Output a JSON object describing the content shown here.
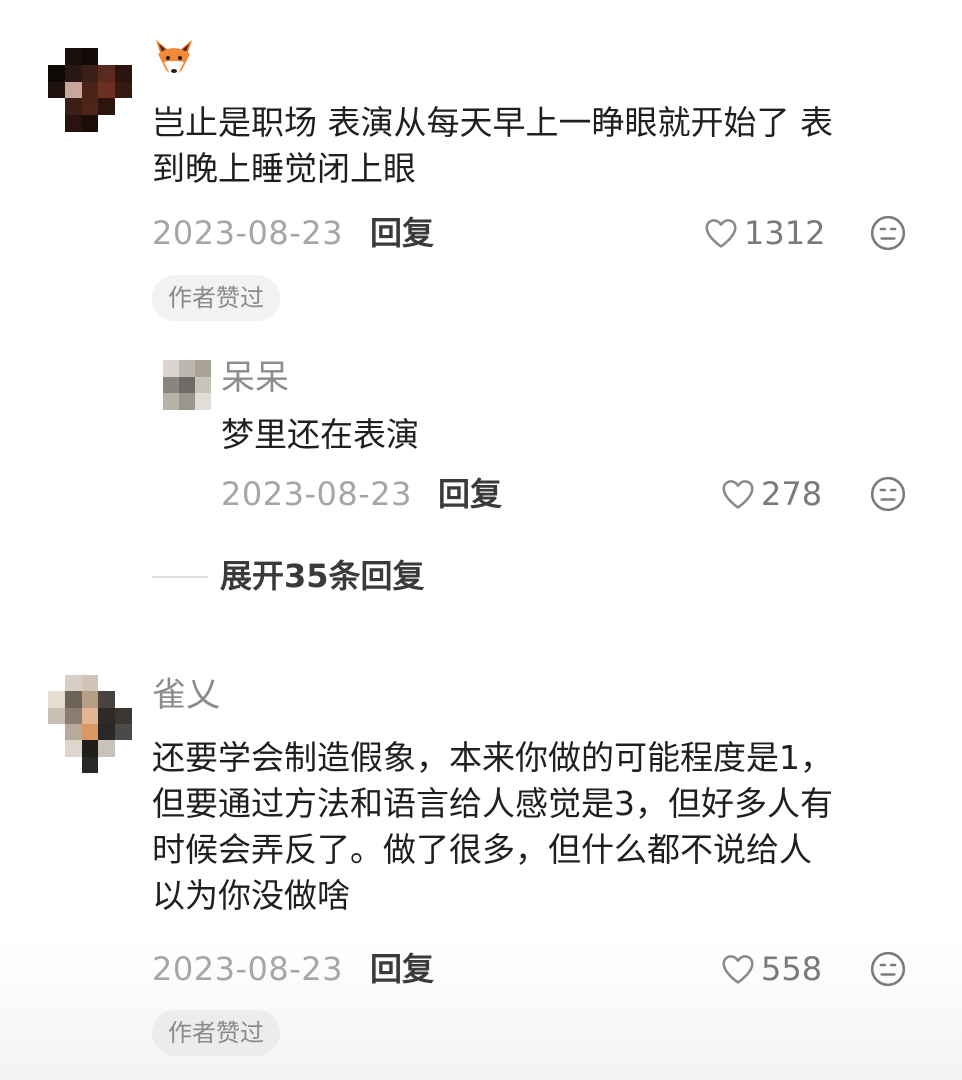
{
  "comments": [
    {
      "username": "",
      "username_emoji": "fox-icon",
      "text": "岂止是职场 表演从每天早上一睁眼就开始了 表\n到晚上睡觉闭上眼",
      "date": "2023-08-23",
      "reply_label": "回复",
      "likes": "1312",
      "badge": "作者赞过"
    },
    {
      "username": "呆呆",
      "text": "梦里还在表演",
      "date": "2023-08-23",
      "reply_label": "回复",
      "likes": "278"
    },
    {
      "username": "雀乂",
      "text": "还要学会制造假象，本来你做的可能程度是1，\n但要通过方法和语言给人感觉是3，但好多人有\n时候会弄反了。做了很多，但什么都不说给人\n以为你没做啥",
      "date": "2023-08-23",
      "reply_label": "回复",
      "likes": "558",
      "badge": "作者赞过"
    }
  ],
  "expand_replies_label": "展开35条回复",
  "icons": {
    "like": "heart-outline-icon",
    "emoji": "neutral-face-icon",
    "avatar": "pixelated-avatar"
  },
  "colors": {
    "text_primary": "#1f1f1f",
    "text_secondary": "#a6a6a6",
    "username": "#8c8c8c",
    "badge_bg": "#f2f2f2"
  }
}
